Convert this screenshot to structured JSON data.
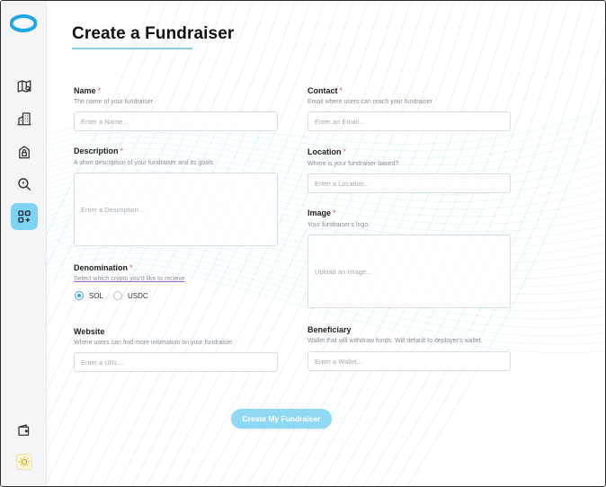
{
  "app": {
    "title": "Create a Fundraiser"
  },
  "sidebar": {
    "items": [
      {
        "icon": "map-icon"
      },
      {
        "icon": "buildings-icon"
      },
      {
        "icon": "home-lock-icon"
      },
      {
        "icon": "search-icon"
      },
      {
        "icon": "apps-add-icon",
        "active": true
      }
    ],
    "bottom": [
      {
        "icon": "wallet-icon"
      },
      {
        "icon": "sun-icon"
      }
    ]
  },
  "form": {
    "name": {
      "label": "Name",
      "required": "*",
      "hint": "The name of your fundraiser",
      "placeholder": "Enter a Name..."
    },
    "description": {
      "label": "Description",
      "required": "*",
      "hint": "A short description of your fundraiser and its goals",
      "placeholder": "Enter a Description..."
    },
    "denomination": {
      "label": "Denomination",
      "required": "*",
      "hint": "Select which crypto you'd like to recieve",
      "options": [
        "SOL",
        "USDC"
      ],
      "selected": "SOL"
    },
    "website": {
      "label": "Website",
      "hint": "Where users can find more infomation on your fundraiser",
      "placeholder": "Enter a URL..."
    },
    "contact": {
      "label": "Contact",
      "required": "*",
      "hint": "Email where users can reach your fundraiser",
      "placeholder": "Enter an Email..."
    },
    "location": {
      "label": "Location",
      "required": "*",
      "hint": "Where is your fundraiser based?",
      "placeholder": "Enter a Location..."
    },
    "image": {
      "label": "Image",
      "required": "*",
      "hint": "Your fundraiser's logo.",
      "placeholder": "Upload an Image..."
    },
    "beneficiary": {
      "label": "Beneficiary",
      "hint": "Wallet that will withdraw funds. Will default to deployer's wallet.",
      "placeholder": "Enter a Wallet..."
    },
    "submit_label": "Create My Fundraiser"
  },
  "colors": {
    "accent": "#7fd3f2",
    "button": "#8fd9f4",
    "required": "#e25555"
  }
}
